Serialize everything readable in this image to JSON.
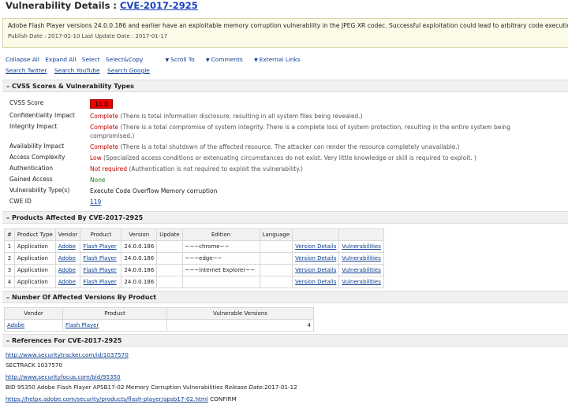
{
  "header": {
    "title_prefix": "Vulnerability Details : ",
    "cve_id": "CVE-2017-2925"
  },
  "summary": {
    "description": "Adobe Flash Player versions 24.0.0.186 and earlier have an exploitable memory corruption vulnerability in the JPEG XR codec. Successful exploitation could lead to arbitrary code execution.",
    "dates": "Publish Date : 2017-01-10 Last Update Date : 2017-01-17"
  },
  "toolbar": {
    "collapse_all": "Collapse All",
    "expand_all": "Expand All",
    "select": "Select",
    "select_copy": "Select&Copy",
    "scroll_to": "Scroll To",
    "comments": "Comments",
    "external_links": "External Links",
    "search_twitter": "Search Twitter",
    "search_youtube": "Search YouTube",
    "search_google": "Search Google"
  },
  "sections": {
    "toggle": "–",
    "cvss": "CVSS Scores & Vulnerability Types",
    "products": "Products Affected By CVE-2017-2925",
    "versions": "Number Of Affected Versions By Product",
    "references": "References For CVE-2017-2925"
  },
  "cvss": {
    "score_label": "CVSS Score",
    "score": "10.0",
    "confidentiality_label": "Confidentiality Impact",
    "confidentiality_value": "Complete",
    "confidentiality_desc": "(There is total information disclosure, resulting in all system files being revealed.)",
    "integrity_label": "Integrity Impact",
    "integrity_value": "Complete",
    "integrity_desc": "(There is a total compromise of system integrity. There is a complete loss of system protection, resulting in the entire system being compromised.)",
    "availability_label": "Availability Impact",
    "availability_value": "Complete",
    "availability_desc": "(There is a total shutdown of the affected resource. The attacker can render the resource completely unavailable.)",
    "access_complexity_label": "Access Complexity",
    "access_complexity_value": "Low",
    "access_complexity_desc": "(Specialized access conditions or extenuating circumstances do not exist. Very little knowledge or skill is required to exploit. )",
    "authentication_label": "Authentication",
    "authentication_value": "Not required",
    "authentication_desc": "(Authentication is not required to exploit the vulnerability.)",
    "gained_access_label": "Gained Access",
    "gained_access_value": "None",
    "vuln_types_label": "Vulnerability Type(s)",
    "vuln_types_value": "Execute Code Overflow Memory corruption",
    "cwe_label": "CWE ID",
    "cwe_value": "119"
  },
  "products_table": {
    "headers": [
      "#",
      "Product Type",
      "Vendor",
      "Product",
      "Version",
      "Update",
      "Edition",
      "Language",
      "",
      ""
    ],
    "rows": [
      {
        "num": "1",
        "type": "Application",
        "vendor": "Adobe",
        "product": "Flash Player",
        "version": "24.0.0.186",
        "update": "",
        "edition": "~~~chrome~~",
        "language": "",
        "details": "Version Details",
        "vulns": "Vulnerabilities"
      },
      {
        "num": "2",
        "type": "Application",
        "vendor": "Adobe",
        "product": "Flash Player",
        "version": "24.0.0.186",
        "update": "",
        "edition": "~~~edge~~",
        "language": "",
        "details": "Version Details",
        "vulns": "Vulnerabilities"
      },
      {
        "num": "3",
        "type": "Application",
        "vendor": "Adobe",
        "product": "Flash Player",
        "version": "24.0.0.186",
        "update": "",
        "edition": "~~~internet Explorer~~",
        "language": "",
        "details": "Version Details",
        "vulns": "Vulnerabilities"
      },
      {
        "num": "4",
        "type": "Application",
        "vendor": "Adobe",
        "product": "Flash Player",
        "version": "24.0.0.186",
        "update": "",
        "edition": "",
        "language": "",
        "details": "Version Details",
        "vulns": "Vulnerabilities"
      }
    ]
  },
  "versions_table": {
    "headers": [
      "Vendor",
      "Product",
      "Vulnerable Versions"
    ],
    "rows": [
      {
        "vendor": "Adobe",
        "product": "Flash Player",
        "count": "4"
      }
    ]
  },
  "references": {
    "r1_url": "http://www.securitytracker.com/id/1037570",
    "r1_text": "SECTRACK 1037570",
    "r2_url": "http://www.securityfocus.com/bid/95350",
    "r2_text": "BID 95350 Adobe Flash Player APSB17-02 Memory Corruption Vulnerabilities",
    "r2_release_label": "Release Date:",
    "r2_release_date": "2017-01-12",
    "r3_url": "https://helpx.adobe.com/security/products/flash-player/apsb17-02.html",
    "r3_text": "CONFIRM"
  }
}
